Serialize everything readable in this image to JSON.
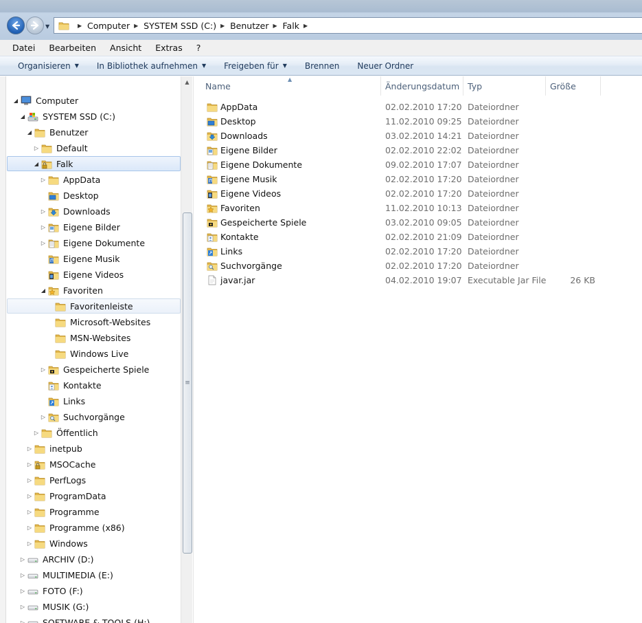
{
  "address": {
    "breadcrumbs": [
      "Computer",
      "SYSTEM SSD (C:)",
      "Benutzer",
      "Falk"
    ]
  },
  "menu": [
    "Datei",
    "Bearbeiten",
    "Ansicht",
    "Extras",
    "?"
  ],
  "commands": [
    {
      "label": "Organisieren",
      "dropdown": true
    },
    {
      "label": "In Bibliothek aufnehmen",
      "dropdown": true
    },
    {
      "label": "Freigeben für",
      "dropdown": true
    },
    {
      "label": "Brennen",
      "dropdown": false
    },
    {
      "label": "Neuer Ordner",
      "dropdown": false
    }
  ],
  "tree": [
    {
      "label": "Computer",
      "icon": "computer-icon",
      "expander": "open"
    },
    {
      "label": "SYSTEM SSD (C:)",
      "icon": "system-drive-icon",
      "expander": "open"
    },
    {
      "label": "Benutzer",
      "icon": "folder-icon",
      "expander": "open"
    },
    {
      "label": "Default",
      "icon": "folder-icon",
      "expander": "closed"
    },
    {
      "label": "Falk",
      "icon": "locked-folder-icon",
      "expander": "open",
      "state": "selected"
    },
    {
      "label": "AppData",
      "icon": "folder-icon",
      "expander": "closed"
    },
    {
      "label": "Desktop",
      "icon": "desktop-folder-icon",
      "expander": "none"
    },
    {
      "label": "Downloads",
      "icon": "downloads-folder-icon",
      "expander": "closed"
    },
    {
      "label": "Eigene Bilder",
      "icon": "pictures-folder-icon",
      "expander": "closed"
    },
    {
      "label": "Eigene Dokumente",
      "icon": "documents-folder-icon",
      "expander": "closed"
    },
    {
      "label": "Eigene Musik",
      "icon": "music-folder-icon",
      "expander": "none"
    },
    {
      "label": "Eigene Videos",
      "icon": "videos-folder-icon",
      "expander": "none"
    },
    {
      "label": "Favoriten",
      "icon": "favorites-folder-icon",
      "expander": "open"
    },
    {
      "label": "Favoritenleiste",
      "icon": "folder-icon",
      "expander": "none",
      "state": "hovered"
    },
    {
      "label": "Microsoft-Websites",
      "icon": "folder-icon",
      "expander": "none"
    },
    {
      "label": "MSN-Websites",
      "icon": "folder-icon",
      "expander": "none"
    },
    {
      "label": "Windows Live",
      "icon": "folder-icon",
      "expander": "none"
    },
    {
      "label": "Gespeicherte Spiele",
      "icon": "games-folder-icon",
      "expander": "closed"
    },
    {
      "label": "Kontakte",
      "icon": "contacts-folder-icon",
      "expander": "none"
    },
    {
      "label": "Links",
      "icon": "links-folder-icon",
      "expander": "none"
    },
    {
      "label": "Suchvorgänge",
      "icon": "searches-folder-icon",
      "expander": "closed"
    },
    {
      "label": "Öffentlich",
      "icon": "folder-icon",
      "expander": "closed"
    },
    {
      "label": "inetpub",
      "icon": "folder-icon",
      "expander": "closed"
    },
    {
      "label": "MSOCache",
      "icon": "locked-folder-icon",
      "expander": "closed"
    },
    {
      "label": "PerfLogs",
      "icon": "folder-icon",
      "expander": "closed"
    },
    {
      "label": "ProgramData",
      "icon": "folder-icon",
      "expander": "closed"
    },
    {
      "label": "Programme",
      "icon": "folder-icon",
      "expander": "closed"
    },
    {
      "label": "Programme (x86)",
      "icon": "folder-icon",
      "expander": "closed"
    },
    {
      "label": "Windows",
      "icon": "folder-icon",
      "expander": "closed"
    },
    {
      "label": "ARCHIV (D:)",
      "icon": "drive-icon",
      "expander": "closed"
    },
    {
      "label": "MULTIMEDIA (E:)",
      "icon": "drive-icon",
      "expander": "closed"
    },
    {
      "label": "FOTO (F:)",
      "icon": "drive-icon",
      "expander": "closed"
    },
    {
      "label": "MUSIK (G:)",
      "icon": "drive-icon",
      "expander": "closed"
    },
    {
      "label": "SOFTWARE & TOOLS (H:)",
      "icon": "drive-icon",
      "expander": "closed"
    }
  ],
  "columns": {
    "name": "Name",
    "date": "Änderungsdatum",
    "type": "Typ",
    "size": "Größe"
  },
  "files": [
    {
      "name": "AppData",
      "date": "02.02.2010 17:20",
      "type": "Dateiordner",
      "size": "",
      "icon": "folder-icon"
    },
    {
      "name": "Desktop",
      "date": "11.02.2010 09:25",
      "type": "Dateiordner",
      "size": "",
      "icon": "desktop-folder-icon"
    },
    {
      "name": "Downloads",
      "date": "03.02.2010 14:21",
      "type": "Dateiordner",
      "size": "",
      "icon": "downloads-folder-icon"
    },
    {
      "name": "Eigene Bilder",
      "date": "02.02.2010 22:02",
      "type": "Dateiordner",
      "size": "",
      "icon": "pictures-folder-icon"
    },
    {
      "name": "Eigene Dokumente",
      "date": "09.02.2010 17:07",
      "type": "Dateiordner",
      "size": "",
      "icon": "documents-folder-icon"
    },
    {
      "name": "Eigene Musik",
      "date": "02.02.2010 17:20",
      "type": "Dateiordner",
      "size": "",
      "icon": "music-folder-icon"
    },
    {
      "name": "Eigene Videos",
      "date": "02.02.2010 17:20",
      "type": "Dateiordner",
      "size": "",
      "icon": "videos-folder-icon"
    },
    {
      "name": "Favoriten",
      "date": "11.02.2010 10:13",
      "type": "Dateiordner",
      "size": "",
      "icon": "favorites-folder-icon"
    },
    {
      "name": "Gespeicherte Spiele",
      "date": "03.02.2010 09:05",
      "type": "Dateiordner",
      "size": "",
      "icon": "games-folder-icon"
    },
    {
      "name": "Kontakte",
      "date": "02.02.2010 21:09",
      "type": "Dateiordner",
      "size": "",
      "icon": "contacts-folder-icon"
    },
    {
      "name": "Links",
      "date": "02.02.2010 17:20",
      "type": "Dateiordner",
      "size": "",
      "icon": "links-folder-icon"
    },
    {
      "name": "Suchvorgänge",
      "date": "02.02.2010 17:20",
      "type": "Dateiordner",
      "size": "",
      "icon": "searches-folder-icon"
    },
    {
      "name": "javar.jar",
      "date": "04.02.2010 19:07",
      "type": "Executable Jar File",
      "size": "26 KB",
      "icon": "jar-file-icon"
    }
  ]
}
